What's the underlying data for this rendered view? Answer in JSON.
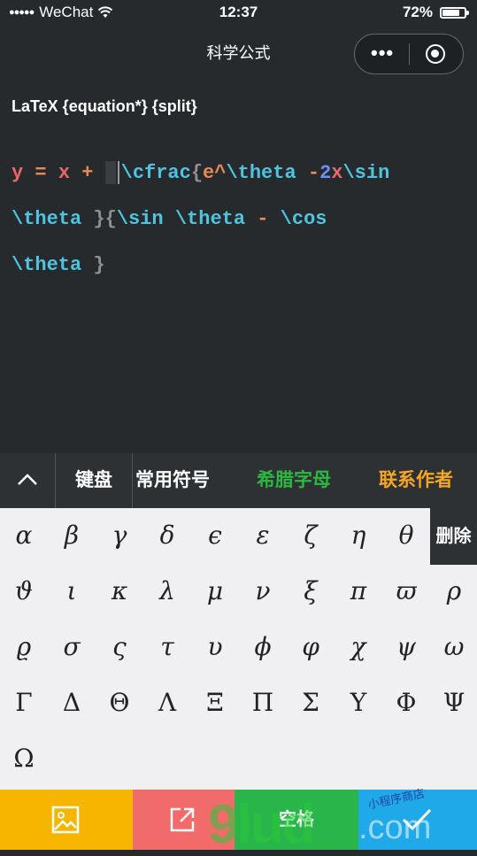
{
  "status_bar": {
    "signal_dots": "●●●●●",
    "carrier": "WeChat",
    "time": "12:37",
    "battery_percent": "72%",
    "battery_level": 0.72
  },
  "nav": {
    "title": "科学公式",
    "more_icon": "more-dots-icon",
    "close_icon": "record-circle-icon"
  },
  "editor": {
    "mode_label": "LaTeX {equation*} {split}",
    "lines": [
      [
        "y",
        " = ",
        "x",
        " + ",
        "\\cfrac",
        "{",
        "e",
        "^",
        "\\theta",
        " -",
        "2",
        "x",
        "\\sin"
      ],
      [
        "\\theta",
        " }",
        "{",
        "\\sin",
        " ",
        "\\theta",
        " - ",
        "\\cos"
      ],
      [
        "\\theta",
        " }"
      ]
    ]
  },
  "toolbar": {
    "collapse_icon": "chevron-up-icon",
    "keyboard": "键盘",
    "common_symbols": "常用符号",
    "greek_letters": "希腊字母",
    "contact_author": "联系作者",
    "greek_color": "#2bb842",
    "contact_color": "#f5a623"
  },
  "keyboard": {
    "delete_label": "删除",
    "row1": [
      "α",
      "β",
      "γ",
      "δ",
      "ϵ",
      "ε",
      "ζ",
      "η",
      "θ"
    ],
    "row2": [
      "ϑ",
      "ι",
      "κ",
      "λ",
      "μ",
      "ν",
      "ξ",
      "π",
      "ϖ",
      "ρ"
    ],
    "row3": [
      "ϱ",
      "σ",
      "ς",
      "τ",
      "υ",
      "ϕ",
      "φ",
      "χ",
      "ψ",
      "ω"
    ],
    "row4": [
      "Γ",
      "Δ",
      "Θ",
      "Λ",
      "Ξ",
      "Π",
      "Σ",
      "Υ",
      "Φ",
      "Ψ"
    ],
    "row5": [
      "Ω"
    ]
  },
  "bottom_bar": {
    "image_icon": "image-icon",
    "share_icon": "share-out-icon",
    "space_label": "空格",
    "confirm_icon": "checkmark-icon"
  },
  "watermark": {
    "big": "9lud",
    "com": ".com",
    "small": "小程序商店"
  }
}
